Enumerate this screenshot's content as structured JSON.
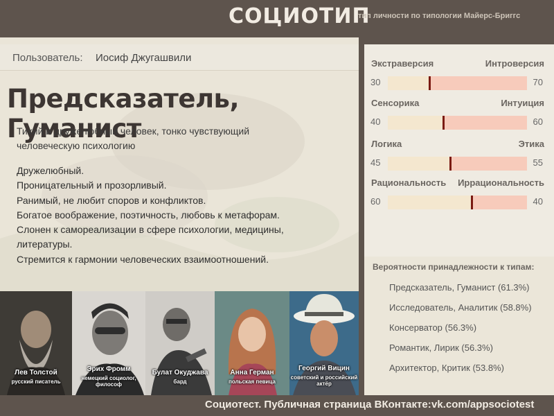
{
  "header": {
    "brand": "СОЦИОТИП",
    "tagline": "тип личности по типологии Майерс-Бриггс"
  },
  "user": {
    "label": "Пользователь:",
    "name": "Иосиф Джугашвили"
  },
  "type_title": "Предсказатель, Гуманист",
  "summary": "Тихий и дружелюбный человек, тонко чувствующий человеческую психологию",
  "traits": [
    "Дружелюбный.",
    "Проницательный и прозорливый.",
    "Ранимый, не любит споров и конфликтов.",
    "Богатое воображение, поэтичность, любовь к метафорам.",
    "Слонен к самореализации в сфере психологии, медицины, литературы.",
    "Стремится к гармонии человеческих взаимоотношений."
  ],
  "scales": [
    {
      "left": "Экстраверсия",
      "right": "Интроверсия",
      "left_value": "30",
      "right_value": "70",
      "ratio": 0.3
    },
    {
      "left": "Сенсорика",
      "right": "Интуиция",
      "left_value": "40",
      "right_value": "60",
      "ratio": 0.4
    },
    {
      "left": "Логика",
      "right": "Этика",
      "left_value": "45",
      "right_value": "55",
      "ratio": 0.45
    },
    {
      "left": "Рациональность",
      "right": "Иррациональность",
      "left_value": "60",
      "right_value": "40",
      "ratio": 0.6
    }
  ],
  "probabilities": {
    "title": "Вероятности принадлежности к типам:",
    "items": [
      "Предсказатель, Гуманист (61.3%)",
      "Исследователь, Аналитик (58.8%)",
      "Консерватор (56.3%)",
      "Романтик, Лирик (56.3%)",
      "Архитектор, Критик (53.8%)"
    ]
  },
  "famous": [
    {
      "name": "Лев Толстой",
      "role": [
        "русский писатель"
      ]
    },
    {
      "name": "Эрих Фромм",
      "role": [
        "немецкий социолог,",
        "философ"
      ]
    },
    {
      "name": "Булат Окуджава",
      "role": [
        "бард"
      ]
    },
    {
      "name": "Анна Герман",
      "role": [
        "польская певица"
      ]
    },
    {
      "name": "Георгий Вицин",
      "role": [
        "советский и российский",
        "актёр"
      ]
    }
  ],
  "footer": {
    "text": "Социотест. Публичная страница ВКонтакте:",
    "link": "vk.com/appsociotest"
  },
  "colors": {
    "bar_dark": "#5e544d",
    "bar_left_fill": "#f4e7cf",
    "bar_right_fill": "#f7cbbb",
    "marker": "#7a1a12"
  }
}
